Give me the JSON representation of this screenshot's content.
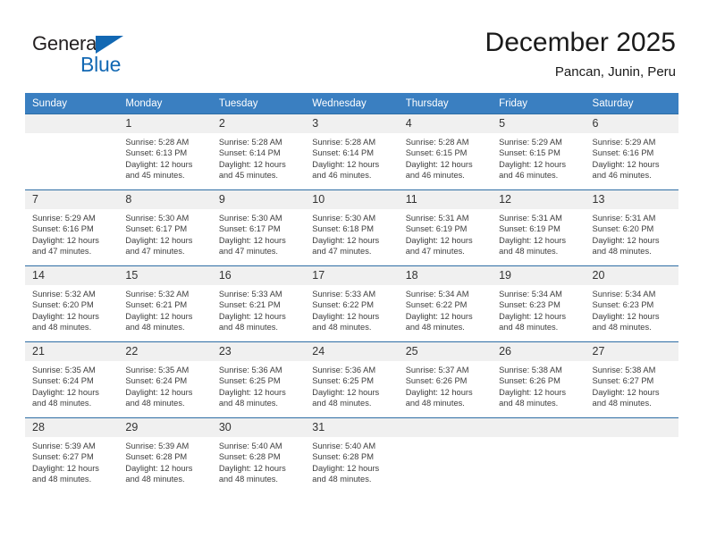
{
  "brand": {
    "name_top": "General",
    "name_bottom": "Blue",
    "accent_color": "#1268b3",
    "text_color": "#231f20"
  },
  "header": {
    "title": "December 2025",
    "subtitle": "Pancan, Junin, Peru"
  },
  "theme": {
    "header_row_color": "#3a7fc1",
    "week_separator_color": "#2e6da4",
    "daynum_band_color": "#f0f0f0",
    "body_text_color": "#3d3d3d"
  },
  "weekdays": [
    "Sunday",
    "Monday",
    "Tuesday",
    "Wednesday",
    "Thursday",
    "Friday",
    "Saturday"
  ],
  "weeks": [
    [
      {
        "day": "",
        "sunrise": "",
        "sunset": "",
        "daylight_line1": "",
        "daylight_line2": ""
      },
      {
        "day": "1",
        "sunrise": "Sunrise: 5:28 AM",
        "sunset": "Sunset: 6:13 PM",
        "daylight_line1": "Daylight: 12 hours",
        "daylight_line2": "and 45 minutes."
      },
      {
        "day": "2",
        "sunrise": "Sunrise: 5:28 AM",
        "sunset": "Sunset: 6:14 PM",
        "daylight_line1": "Daylight: 12 hours",
        "daylight_line2": "and 45 minutes."
      },
      {
        "day": "3",
        "sunrise": "Sunrise: 5:28 AM",
        "sunset": "Sunset: 6:14 PM",
        "daylight_line1": "Daylight: 12 hours",
        "daylight_line2": "and 46 minutes."
      },
      {
        "day": "4",
        "sunrise": "Sunrise: 5:28 AM",
        "sunset": "Sunset: 6:15 PM",
        "daylight_line1": "Daylight: 12 hours",
        "daylight_line2": "and 46 minutes."
      },
      {
        "day": "5",
        "sunrise": "Sunrise: 5:29 AM",
        "sunset": "Sunset: 6:15 PM",
        "daylight_line1": "Daylight: 12 hours",
        "daylight_line2": "and 46 minutes."
      },
      {
        "day": "6",
        "sunrise": "Sunrise: 5:29 AM",
        "sunset": "Sunset: 6:16 PM",
        "daylight_line1": "Daylight: 12 hours",
        "daylight_line2": "and 46 minutes."
      }
    ],
    [
      {
        "day": "7",
        "sunrise": "Sunrise: 5:29 AM",
        "sunset": "Sunset: 6:16 PM",
        "daylight_line1": "Daylight: 12 hours",
        "daylight_line2": "and 47 minutes."
      },
      {
        "day": "8",
        "sunrise": "Sunrise: 5:30 AM",
        "sunset": "Sunset: 6:17 PM",
        "daylight_line1": "Daylight: 12 hours",
        "daylight_line2": "and 47 minutes."
      },
      {
        "day": "9",
        "sunrise": "Sunrise: 5:30 AM",
        "sunset": "Sunset: 6:17 PM",
        "daylight_line1": "Daylight: 12 hours",
        "daylight_line2": "and 47 minutes."
      },
      {
        "day": "10",
        "sunrise": "Sunrise: 5:30 AM",
        "sunset": "Sunset: 6:18 PM",
        "daylight_line1": "Daylight: 12 hours",
        "daylight_line2": "and 47 minutes."
      },
      {
        "day": "11",
        "sunrise": "Sunrise: 5:31 AM",
        "sunset": "Sunset: 6:19 PM",
        "daylight_line1": "Daylight: 12 hours",
        "daylight_line2": "and 47 minutes."
      },
      {
        "day": "12",
        "sunrise": "Sunrise: 5:31 AM",
        "sunset": "Sunset: 6:19 PM",
        "daylight_line1": "Daylight: 12 hours",
        "daylight_line2": "and 48 minutes."
      },
      {
        "day": "13",
        "sunrise": "Sunrise: 5:31 AM",
        "sunset": "Sunset: 6:20 PM",
        "daylight_line1": "Daylight: 12 hours",
        "daylight_line2": "and 48 minutes."
      }
    ],
    [
      {
        "day": "14",
        "sunrise": "Sunrise: 5:32 AM",
        "sunset": "Sunset: 6:20 PM",
        "daylight_line1": "Daylight: 12 hours",
        "daylight_line2": "and 48 minutes."
      },
      {
        "day": "15",
        "sunrise": "Sunrise: 5:32 AM",
        "sunset": "Sunset: 6:21 PM",
        "daylight_line1": "Daylight: 12 hours",
        "daylight_line2": "and 48 minutes."
      },
      {
        "day": "16",
        "sunrise": "Sunrise: 5:33 AM",
        "sunset": "Sunset: 6:21 PM",
        "daylight_line1": "Daylight: 12 hours",
        "daylight_line2": "and 48 minutes."
      },
      {
        "day": "17",
        "sunrise": "Sunrise: 5:33 AM",
        "sunset": "Sunset: 6:22 PM",
        "daylight_line1": "Daylight: 12 hours",
        "daylight_line2": "and 48 minutes."
      },
      {
        "day": "18",
        "sunrise": "Sunrise: 5:34 AM",
        "sunset": "Sunset: 6:22 PM",
        "daylight_line1": "Daylight: 12 hours",
        "daylight_line2": "and 48 minutes."
      },
      {
        "day": "19",
        "sunrise": "Sunrise: 5:34 AM",
        "sunset": "Sunset: 6:23 PM",
        "daylight_line1": "Daylight: 12 hours",
        "daylight_line2": "and 48 minutes."
      },
      {
        "day": "20",
        "sunrise": "Sunrise: 5:34 AM",
        "sunset": "Sunset: 6:23 PM",
        "daylight_line1": "Daylight: 12 hours",
        "daylight_line2": "and 48 minutes."
      }
    ],
    [
      {
        "day": "21",
        "sunrise": "Sunrise: 5:35 AM",
        "sunset": "Sunset: 6:24 PM",
        "daylight_line1": "Daylight: 12 hours",
        "daylight_line2": "and 48 minutes."
      },
      {
        "day": "22",
        "sunrise": "Sunrise: 5:35 AM",
        "sunset": "Sunset: 6:24 PM",
        "daylight_line1": "Daylight: 12 hours",
        "daylight_line2": "and 48 minutes."
      },
      {
        "day": "23",
        "sunrise": "Sunrise: 5:36 AM",
        "sunset": "Sunset: 6:25 PM",
        "daylight_line1": "Daylight: 12 hours",
        "daylight_line2": "and 48 minutes."
      },
      {
        "day": "24",
        "sunrise": "Sunrise: 5:36 AM",
        "sunset": "Sunset: 6:25 PM",
        "daylight_line1": "Daylight: 12 hours",
        "daylight_line2": "and 48 minutes."
      },
      {
        "day": "25",
        "sunrise": "Sunrise: 5:37 AM",
        "sunset": "Sunset: 6:26 PM",
        "daylight_line1": "Daylight: 12 hours",
        "daylight_line2": "and 48 minutes."
      },
      {
        "day": "26",
        "sunrise": "Sunrise: 5:38 AM",
        "sunset": "Sunset: 6:26 PM",
        "daylight_line1": "Daylight: 12 hours",
        "daylight_line2": "and 48 minutes."
      },
      {
        "day": "27",
        "sunrise": "Sunrise: 5:38 AM",
        "sunset": "Sunset: 6:27 PM",
        "daylight_line1": "Daylight: 12 hours",
        "daylight_line2": "and 48 minutes."
      }
    ],
    [
      {
        "day": "28",
        "sunrise": "Sunrise: 5:39 AM",
        "sunset": "Sunset: 6:27 PM",
        "daylight_line1": "Daylight: 12 hours",
        "daylight_line2": "and 48 minutes."
      },
      {
        "day": "29",
        "sunrise": "Sunrise: 5:39 AM",
        "sunset": "Sunset: 6:28 PM",
        "daylight_line1": "Daylight: 12 hours",
        "daylight_line2": "and 48 minutes."
      },
      {
        "day": "30",
        "sunrise": "Sunrise: 5:40 AM",
        "sunset": "Sunset: 6:28 PM",
        "daylight_line1": "Daylight: 12 hours",
        "daylight_line2": "and 48 minutes."
      },
      {
        "day": "31",
        "sunrise": "Sunrise: 5:40 AM",
        "sunset": "Sunset: 6:28 PM",
        "daylight_line1": "Daylight: 12 hours",
        "daylight_line2": "and 48 minutes."
      },
      {
        "day": "",
        "sunrise": "",
        "sunset": "",
        "daylight_line1": "",
        "daylight_line2": ""
      },
      {
        "day": "",
        "sunrise": "",
        "sunset": "",
        "daylight_line1": "",
        "daylight_line2": ""
      },
      {
        "day": "",
        "sunrise": "",
        "sunset": "",
        "daylight_line1": "",
        "daylight_line2": ""
      }
    ]
  ]
}
